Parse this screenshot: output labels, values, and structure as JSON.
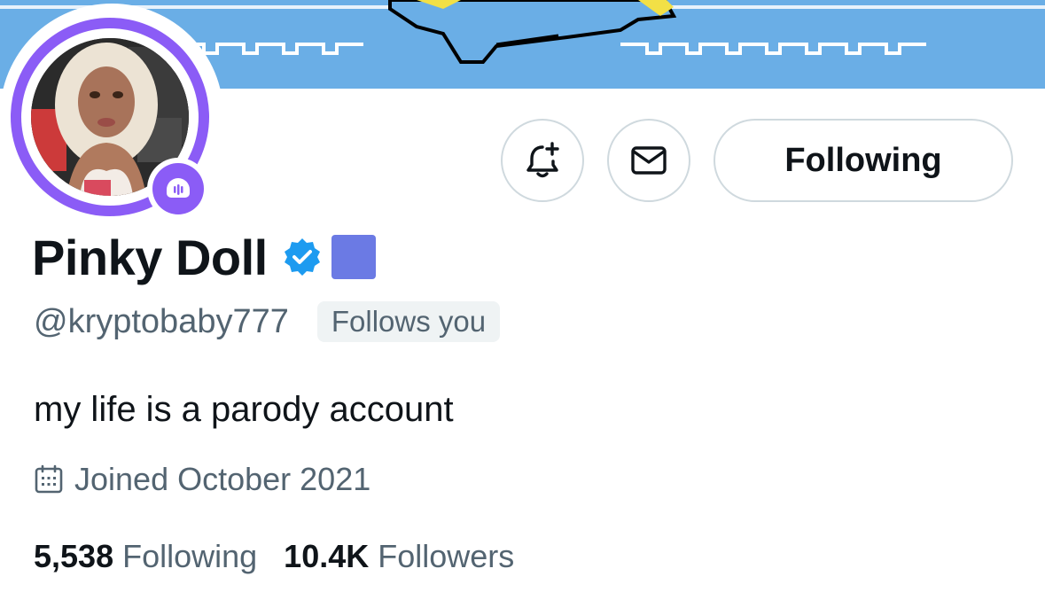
{
  "profile": {
    "display_name": "Pinky Doll",
    "handle": "@kryptobaby777",
    "follows_you_label": "Follows you",
    "bio": "my life is a parody account",
    "joined": "Joined October 2021",
    "stats": {
      "following_count": "5,538",
      "following_label": "Following",
      "followers_count": "10.4K",
      "followers_label": "Followers"
    }
  },
  "actions": {
    "follow_button_label": "Following"
  },
  "icons": {
    "notify": "bell-plus-icon",
    "message": "envelope-icon",
    "verified": "verified-badge-icon",
    "spaces": "spaces-mic-icon",
    "calendar": "calendar-icon"
  },
  "colors": {
    "banner": "#6aaee6",
    "avatar_ring": "#8b5cf6",
    "verified": "#1d9bf0",
    "affiliate_square": "#6b7ae4",
    "muted_text": "#536471"
  }
}
